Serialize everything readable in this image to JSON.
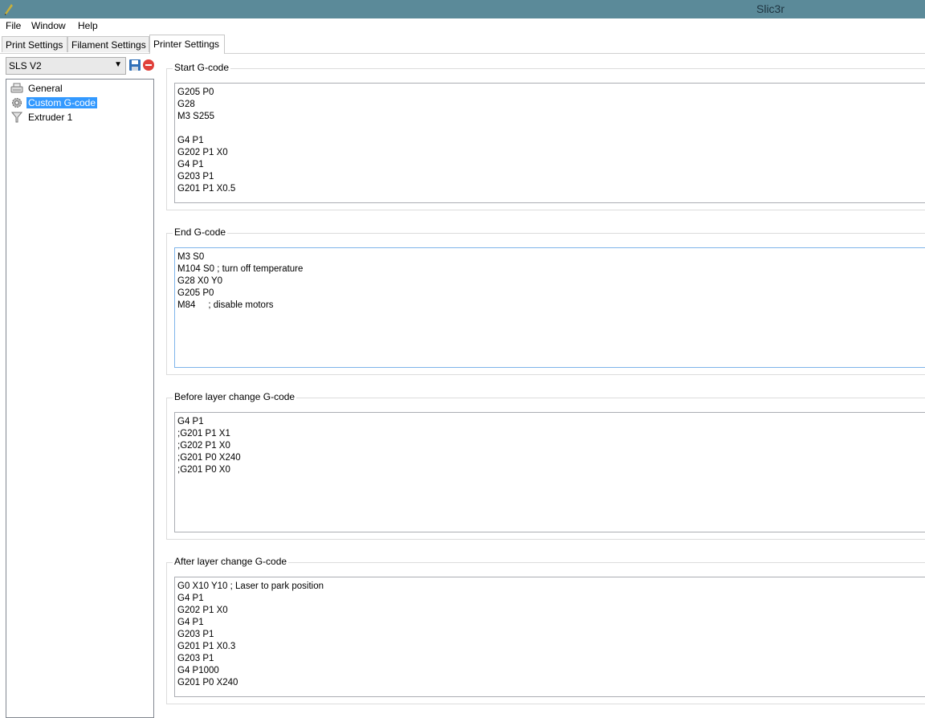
{
  "window": {
    "title": "Slic3r"
  },
  "menu": {
    "items": [
      "File",
      "Window",
      "Help"
    ]
  },
  "tabs": [
    {
      "label": "Print Settings",
      "active": false
    },
    {
      "label": "Filament Settings",
      "active": false
    },
    {
      "label": "Printer Settings",
      "active": true
    }
  ],
  "preset": {
    "selected": "SLS V2"
  },
  "tree": [
    {
      "label": "General",
      "icon": "printer-icon",
      "selected": false
    },
    {
      "label": "Custom G-code",
      "icon": "gear-icon",
      "selected": true
    },
    {
      "label": "Extruder 1",
      "icon": "funnel-icon",
      "selected": false
    }
  ],
  "sections": [
    {
      "title": "Start G-code",
      "value": "G205 P0\nG28\nM3 S255\n\nG4 P1\nG202 P1 X0\nG4 P1\nG203 P1\nG201 P1 X0.5"
    },
    {
      "title": "End G-code",
      "value": "M3 S0\nM104 S0 ; turn off temperature\nG28 X0 Y0\nG205 P0\nM84     ; disable motors"
    },
    {
      "title": "Before layer change G-code",
      "value": "G4 P1\n;G201 P1 X1\n;G202 P1 X0\n;G201 P0 X240\n;G201 P0 X0"
    },
    {
      "title": "After layer change G-code",
      "value": "G0 X10 Y10 ; Laser to park position\nG4 P1\nG202 P1 X0\nG4 P1\nG203 P1\nG201 P1 X0.3\nG203 P1\nG4 P1000\nG201 P0 X240"
    }
  ],
  "colors": {
    "titlebar": "#5b8a99",
    "selection": "#3399ff"
  }
}
